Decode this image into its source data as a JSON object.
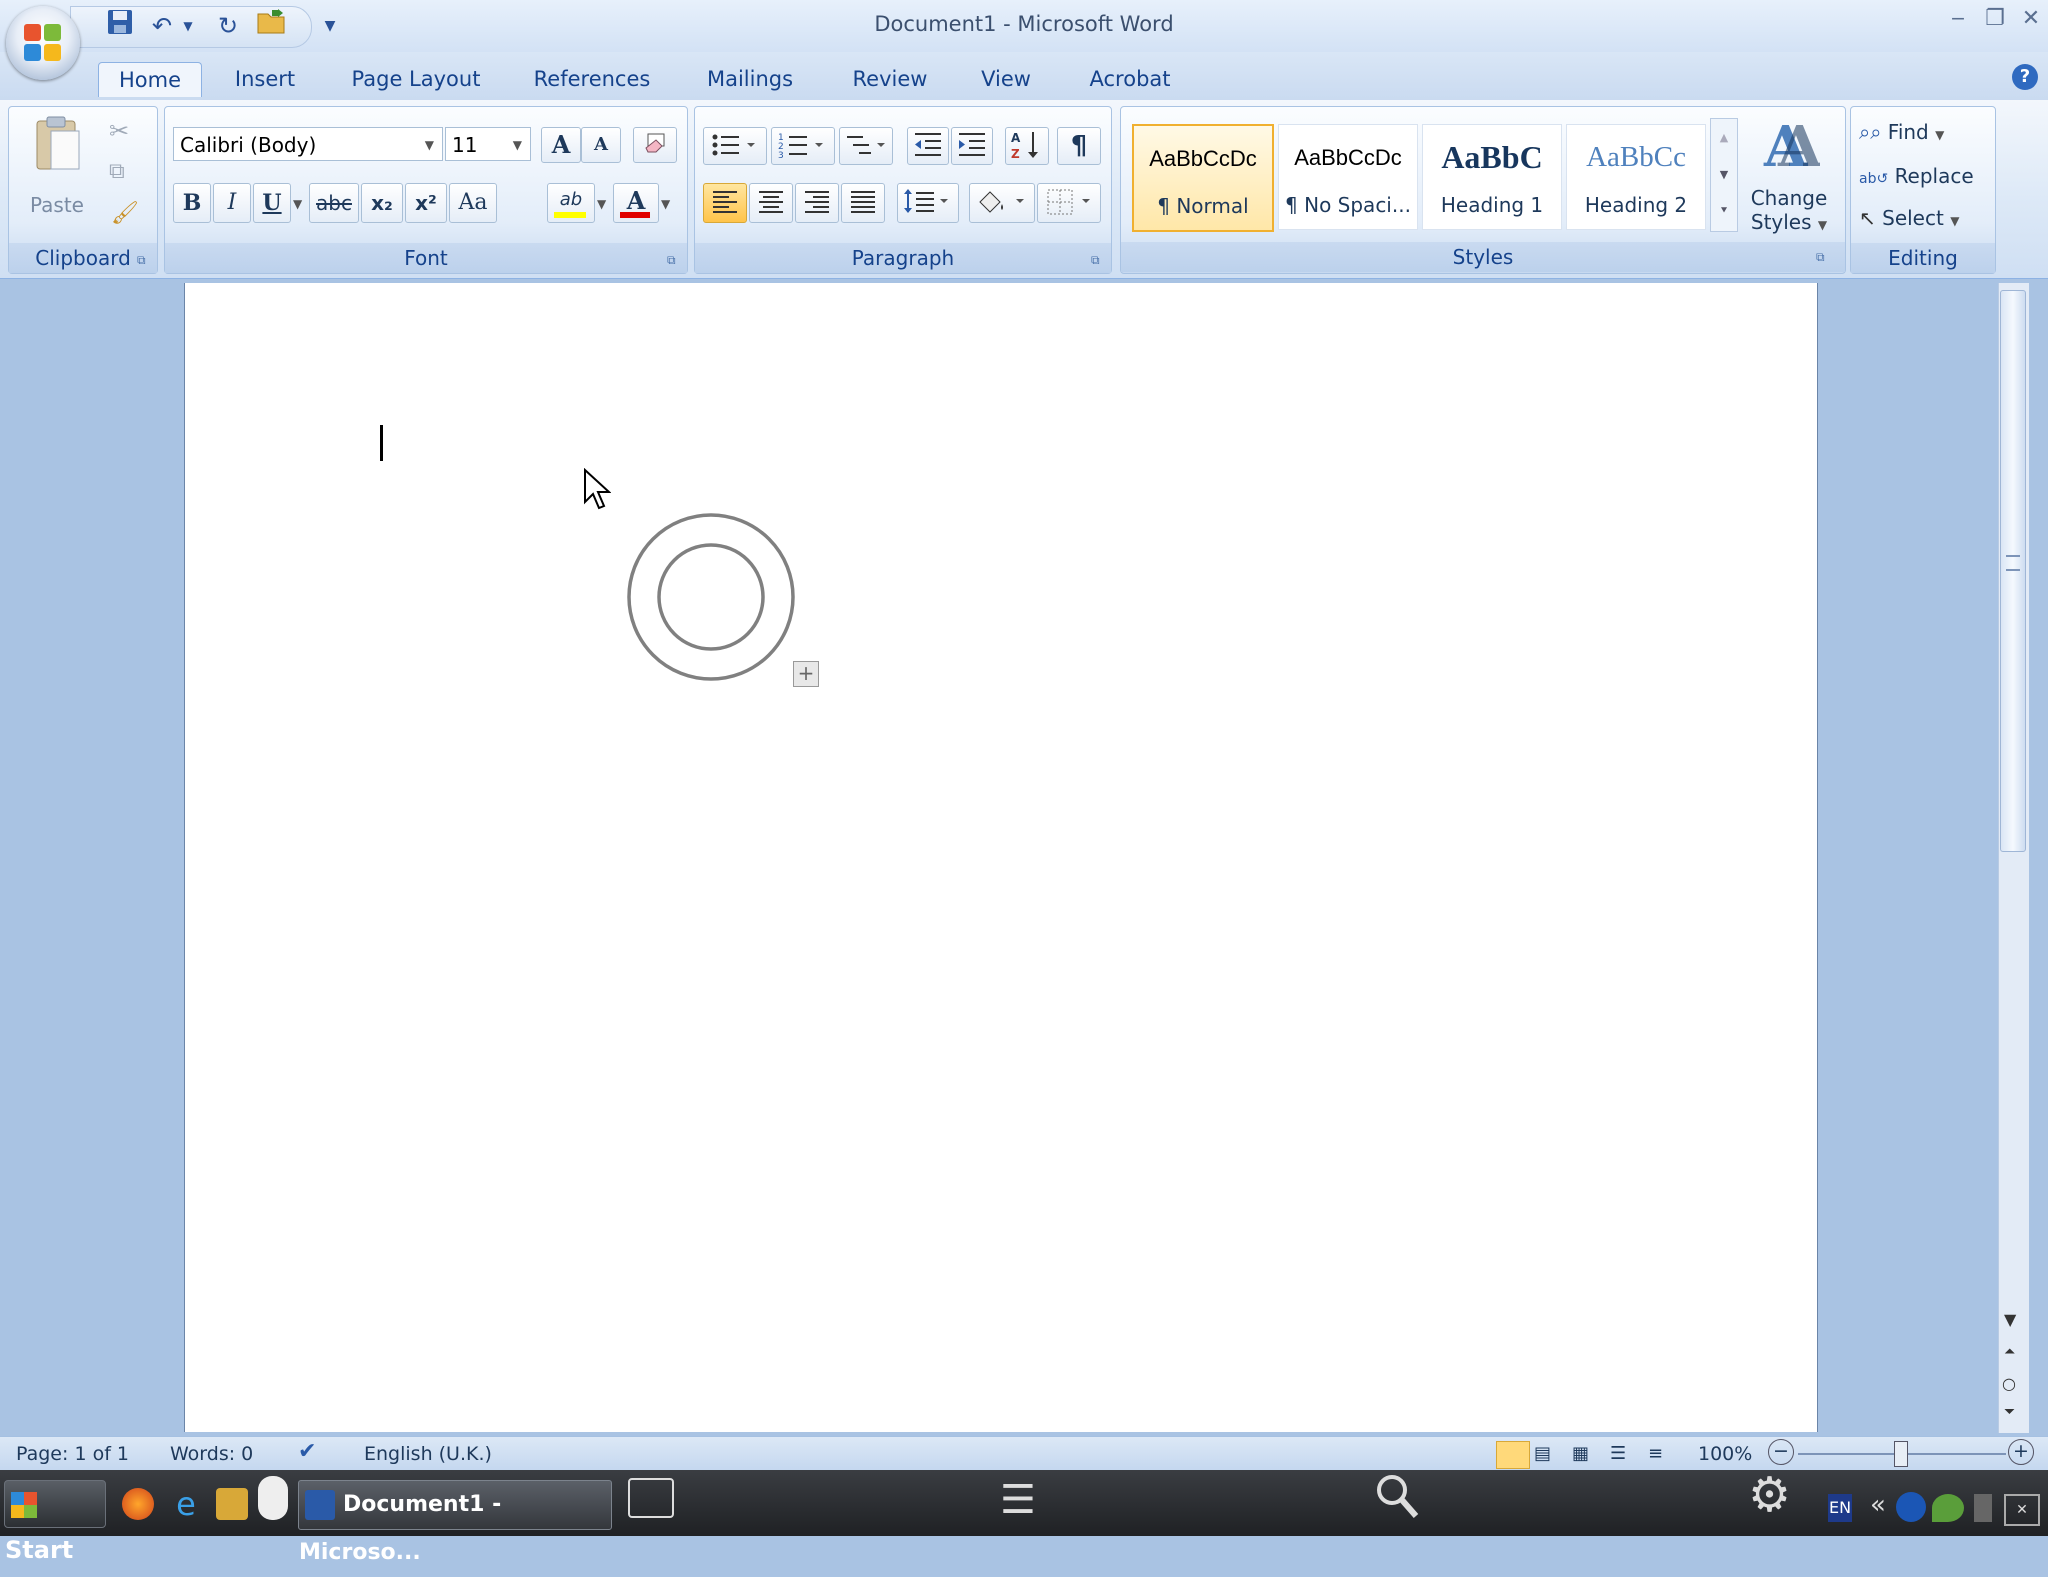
{
  "window": {
    "title": "Document1 - Microsoft Word",
    "minimize": "‒",
    "restore": "❐",
    "close": "✕"
  },
  "tabs": [
    "Home",
    "Insert",
    "Page Layout",
    "References",
    "Mailings",
    "Review",
    "View",
    "Acrobat"
  ],
  "ribbon": {
    "clipboard": {
      "label": "Clipboard",
      "paste": "Paste"
    },
    "font": {
      "label": "Font",
      "font_name": "Calibri (Body)",
      "font_size": "11",
      "bold": "B",
      "italic": "I",
      "underline": "U",
      "strike": "abc",
      "subscript": "x₂",
      "superscript": "x²",
      "change_case": "Aa",
      "grow": "A",
      "shrink": "A",
      "font_color": "A",
      "highlight": "ab"
    },
    "paragraph": {
      "label": "Paragraph",
      "pilcrow": "¶"
    },
    "styles": {
      "label": "Styles",
      "items": [
        {
          "preview": "AaBbCcDc",
          "name": "¶ Normal"
        },
        {
          "preview": "AaBbCcDc",
          "name": "¶ No Spaci..."
        },
        {
          "preview": "AaBbC",
          "name": "Heading 1"
        },
        {
          "preview": "AaBbCc",
          "name": "Heading 2"
        }
      ],
      "change_styles_1": "Change",
      "change_styles_2": "Styles"
    },
    "editing": {
      "label": "Editing",
      "find": "Find",
      "replace": "Replace",
      "select": "Select"
    }
  },
  "status": {
    "page": "Page: 1 of 1",
    "words": "Words: 0",
    "language": "English (U.K.)",
    "zoom": "100%"
  },
  "taskbar": {
    "start": "Start",
    "word_task": "Document1 - Microso...",
    "lang": "EN"
  },
  "colors": {
    "accent": "#15428b",
    "ribbon_bg": "#dde9f7",
    "font_color_bar": "#e00000",
    "highlight_bar": "#ffff00"
  }
}
